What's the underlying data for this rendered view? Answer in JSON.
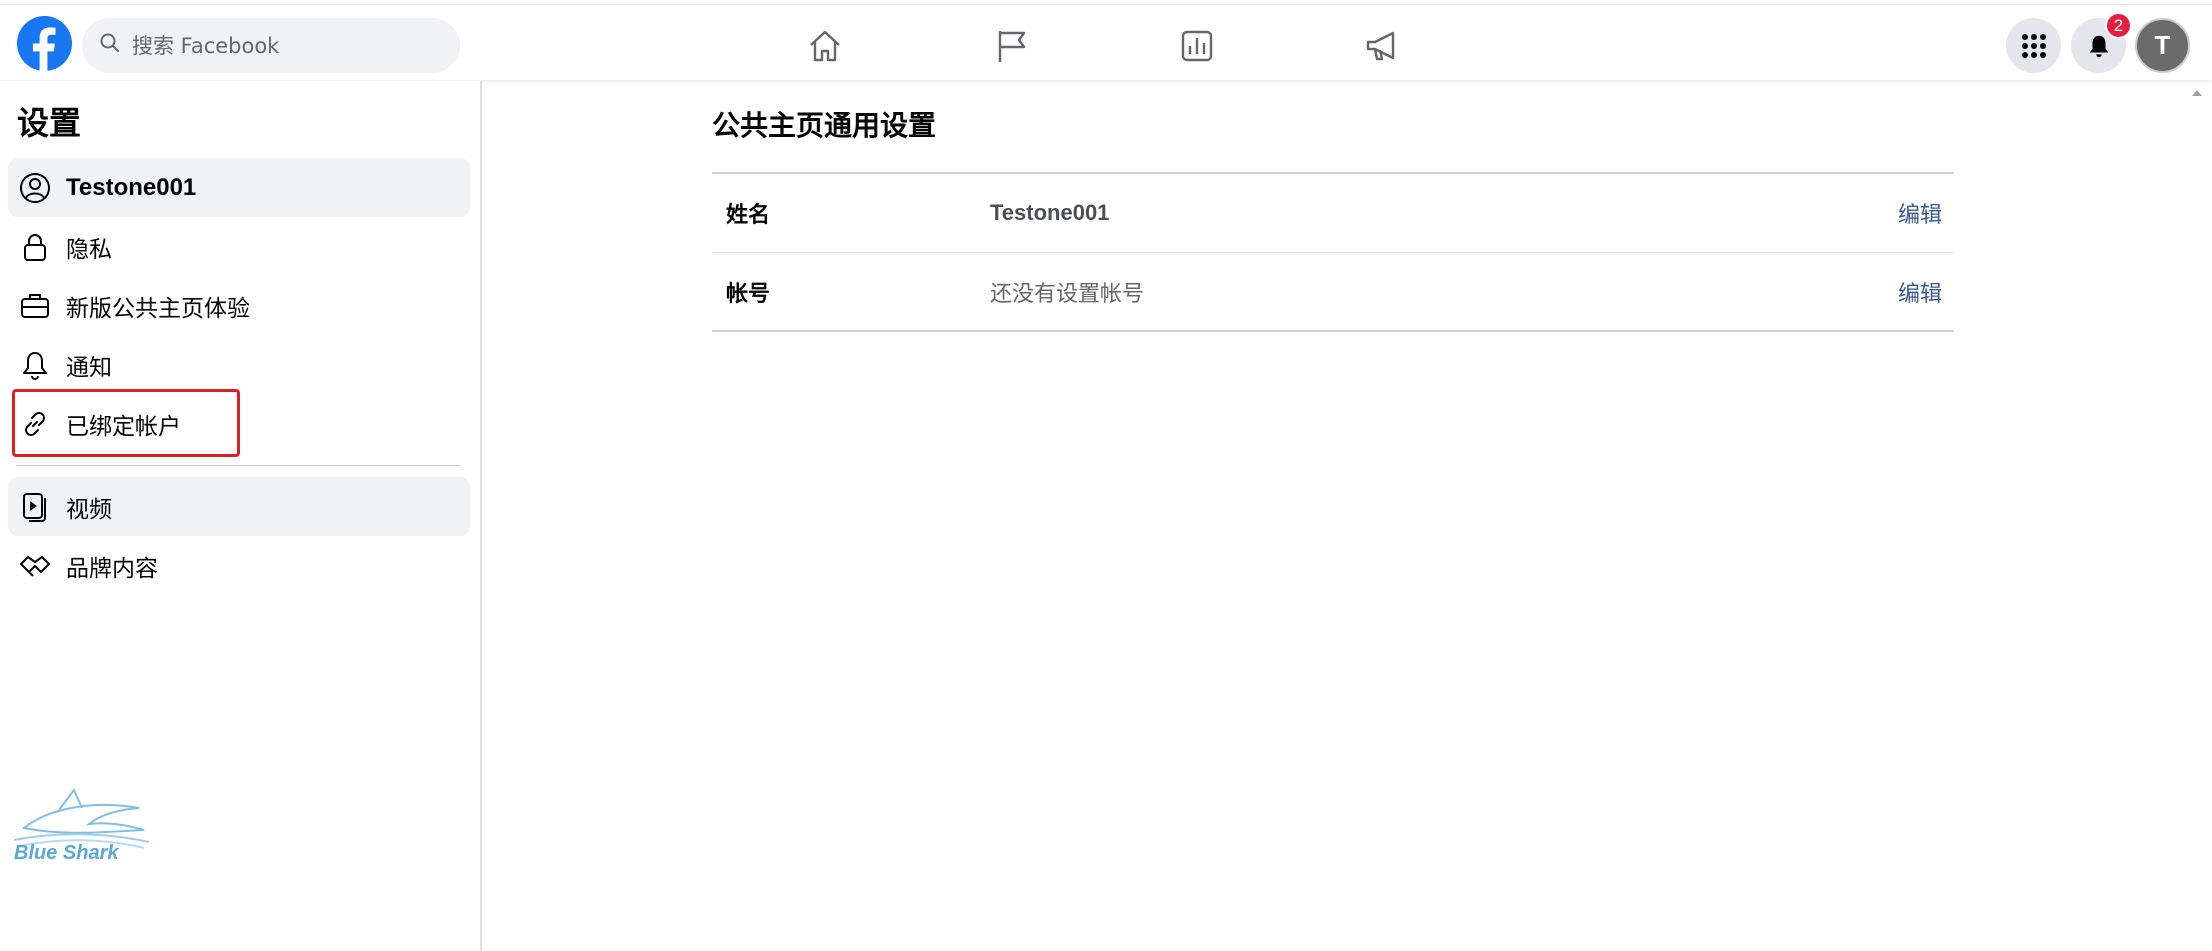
{
  "header": {
    "search": {
      "placeholder": "搜索 Facebook"
    },
    "nav_icons": [
      "home-icon",
      "flag-icon",
      "insights-icon",
      "megaphone-icon"
    ],
    "notifications_badge": "2",
    "avatar_letter": "T",
    "brand_color": "#1877f2"
  },
  "sidebar": {
    "title": "设置",
    "items": [
      {
        "label": "Testone001",
        "icon": "user-circle-icon",
        "active": true
      },
      {
        "label": "隐私",
        "icon": "lock-icon",
        "active": false
      },
      {
        "label": "新版公共主页体验",
        "icon": "briefcase-icon",
        "active": false
      },
      {
        "label": "通知",
        "icon": "bell-icon",
        "active": false
      },
      {
        "label": "已绑定帐户",
        "icon": "link-icon",
        "active": false,
        "highlighted": true
      },
      {
        "label": "视频",
        "icon": "video-icon",
        "active": true
      },
      {
        "label": "品牌内容",
        "icon": "handshake-icon",
        "active": false
      }
    ]
  },
  "main": {
    "title": "公共主页通用设置",
    "rows": [
      {
        "key": "姓名",
        "value": "Testone001",
        "action": "编辑"
      },
      {
        "key": "帐号",
        "value": "还没有设置帐号",
        "action": "编辑"
      }
    ]
  },
  "watermark": {
    "text": "Blue Shark"
  }
}
